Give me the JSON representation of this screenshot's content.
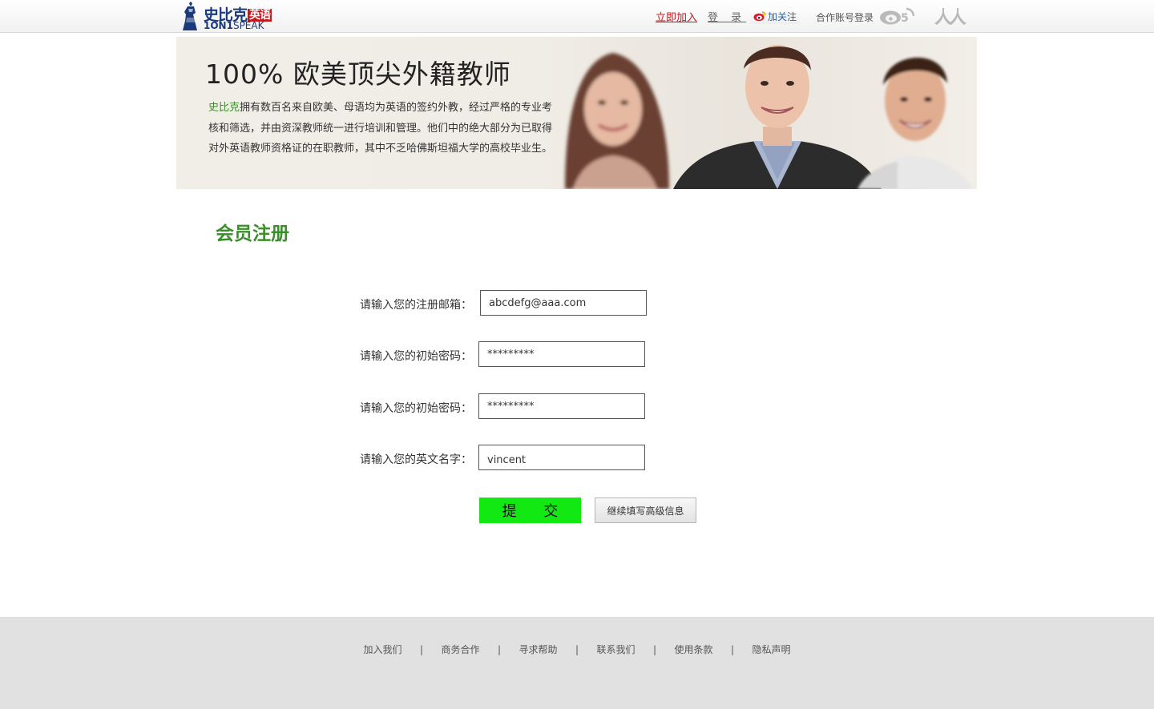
{
  "header": {
    "logo": {
      "brand_cn": "史比克",
      "brand_badge": "英语",
      "brand_en_bold": "1ON1",
      "brand_en_thin": "SPEAK"
    },
    "join_label": "立即加入",
    "login_label": "登 录",
    "weibo_follow_label": "加关注",
    "partner_login_label": "合作账号登录",
    "icons": [
      "weibo-icon",
      "renren-icon"
    ]
  },
  "banner": {
    "title": "100% 欧美顶尖外籍教师",
    "desc_brand": "史比克",
    "desc_text": "拥有数百名来自欧美、母语均为英语的签约外教，经过严格的专业考核和筛选，并由资深教师统一进行培训和管理。他们中的绝大部分为已取得对外英语教师资格证的在职教师，其中不乏哈佛斯坦福大学的高校毕业生。"
  },
  "section": {
    "title": "会员注册"
  },
  "form": {
    "email_label": "请输入您的注册邮箱：",
    "email_value": "abcdefg@aaa.com",
    "password_label": "请输入您的初始密码：",
    "password_value": "*********",
    "password_confirm_label": "请输入您的初始密码：",
    "password_confirm_value": "*********",
    "english_name_label": "请输入您的英文名字：",
    "english_name_value": "vincent",
    "submit_label": "提 交",
    "advanced_label": "继续填写高级信息"
  },
  "footer": {
    "links": [
      "加入我们",
      "商务合作",
      "寻求帮助",
      "联系我们",
      "使用条款",
      "隐私声明"
    ],
    "separator": "|"
  },
  "colors": {
    "brand_green": "#3a8f2a",
    "submit_green": "#12e812",
    "brand_red": "#c8161d",
    "brand_blue": "#1b3a7a"
  }
}
